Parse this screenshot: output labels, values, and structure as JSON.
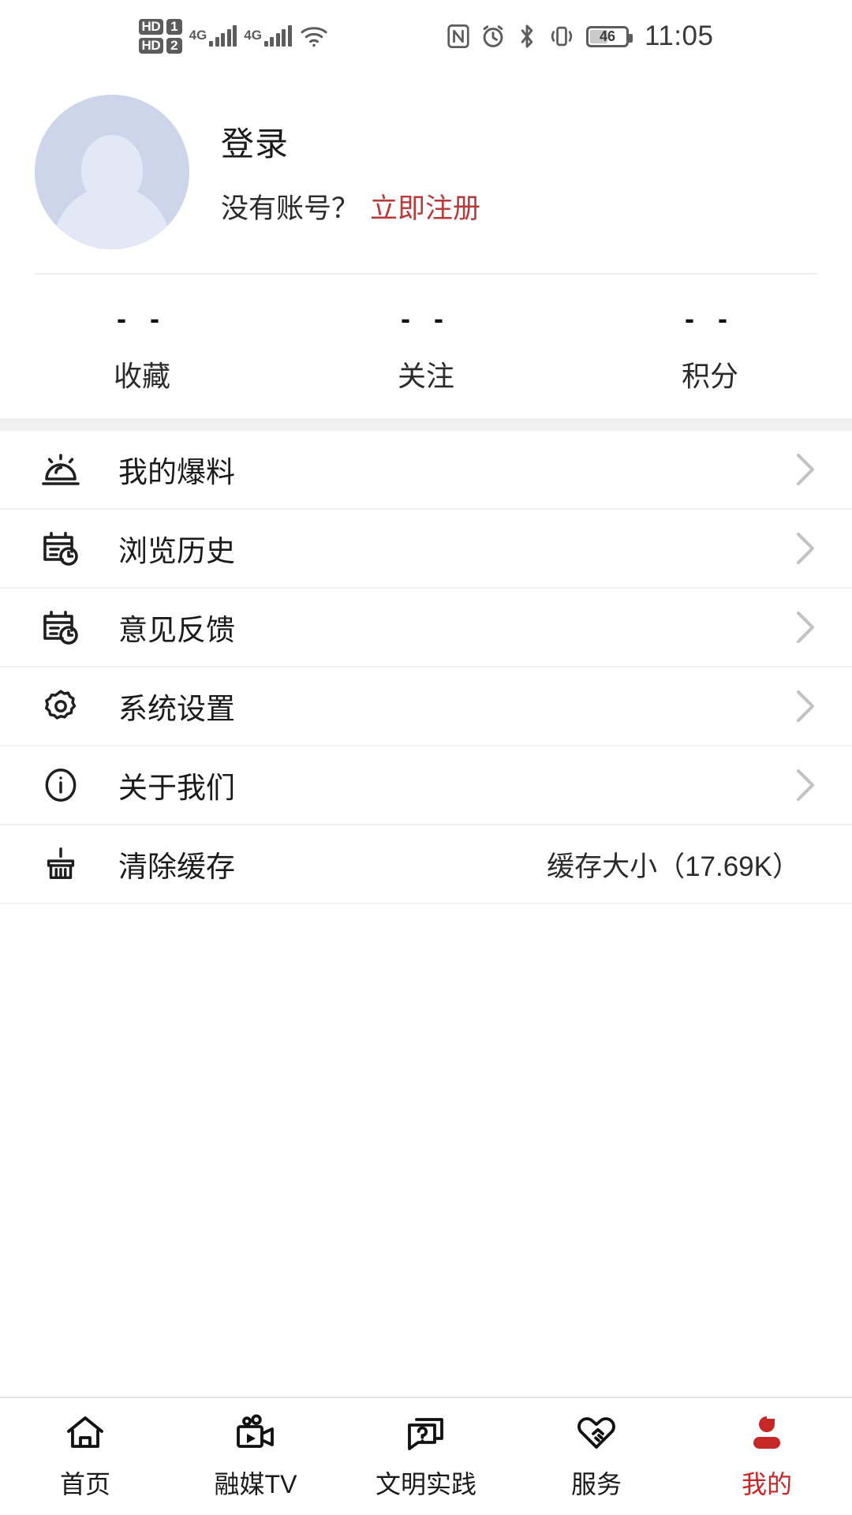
{
  "status_bar": {
    "hd1_label": "HD",
    "hd2_label": "HD",
    "sim1_label": "1",
    "sim2_label": "2",
    "network1": "4G",
    "network2": "4G",
    "wifi_icon": "wifi-icon",
    "nfc_icon": "nfc-icon",
    "alarm_icon": "alarm-icon",
    "bluetooth_icon": "bluetooth-icon",
    "vibrate_icon": "vibrate-icon",
    "battery_level": "46",
    "time": "11:05"
  },
  "profile": {
    "avatar_icon": "default-avatar",
    "login_label": "登录",
    "no_account_text": "没有账号？",
    "register_label": "立即注册",
    "register_color": "#b93a3a"
  },
  "stats": [
    {
      "value": "- -",
      "label": "收藏"
    },
    {
      "value": "- -",
      "label": "关注"
    },
    {
      "value": "- -",
      "label": "积分"
    }
  ],
  "menu": [
    {
      "icon": "siren-icon",
      "label": "我的爆料",
      "value": "",
      "chevron": true
    },
    {
      "icon": "calendar-clock-icon",
      "label": "浏览历史",
      "value": "",
      "chevron": true
    },
    {
      "icon": "calendar-clock-icon",
      "label": "意见反馈",
      "value": "",
      "chevron": true
    },
    {
      "icon": "gear-icon",
      "label": "系统设置",
      "value": "",
      "chevron": true
    },
    {
      "icon": "info-circle-icon",
      "label": "关于我们",
      "value": "",
      "chevron": true
    },
    {
      "icon": "broom-icon",
      "label": "清除缓存",
      "value": "缓存大小（17.69K）",
      "chevron": false
    }
  ],
  "tabbar": {
    "active_color": "#c62828",
    "items": [
      {
        "icon": "home-icon",
        "label": "首页",
        "active": false
      },
      {
        "icon": "video-camera-icon",
        "label": "融媒TV",
        "active": false
      },
      {
        "icon": "question-bubble-icon",
        "label": "文明实践",
        "active": false
      },
      {
        "icon": "handshake-heart-icon",
        "label": "服务",
        "active": false
      },
      {
        "icon": "person-icon",
        "label": "我的",
        "active": true
      }
    ]
  }
}
